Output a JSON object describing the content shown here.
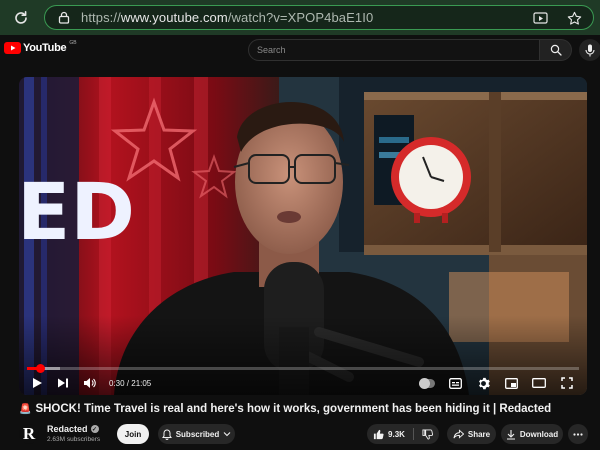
{
  "browser": {
    "url_prefix": "https://",
    "url_host": "www.youtube.com",
    "url_path": "/watch?v=XPOP4baE1I0"
  },
  "header": {
    "logo_text": "YouTube",
    "region": "GB",
    "search_placeholder": "Search"
  },
  "player": {
    "time": "0:30 / 21:05",
    "progress_fraction": 0.024,
    "buffer_fraction": 0.06,
    "scene_text": "ED",
    "autoplay_on": false
  },
  "video": {
    "title_emoji": "🚨",
    "title": "SHOCK! Time Travel is real and here's how it works, government has been hiding it | Redacted"
  },
  "channel": {
    "avatar_letter": "R",
    "name": "Redacted",
    "subscribers": "2.63M subscribers",
    "join_label": "Join",
    "subscribed_label": "Subscribed"
  },
  "actions": {
    "likes": "9.3K",
    "share_label": "Share",
    "download_label": "Download"
  }
}
